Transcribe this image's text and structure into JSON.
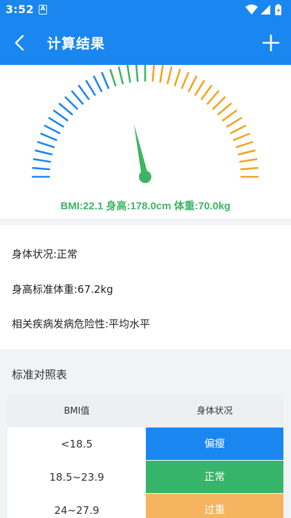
{
  "status_bar": {
    "time": "3:52",
    "notification_icon": "a-icon",
    "icons": [
      "wifi-icon",
      "signal-icon",
      "battery-icon"
    ]
  },
  "app_bar": {
    "title": "计算结果",
    "back_icon": "back-arrow-icon",
    "add_icon": "plus-icon"
  },
  "gauge": {
    "reading": "BMI:22.1  身高:178.0cm  体重:70.0kg",
    "colors": {
      "underweight": "#1a86f0",
      "normal": "#3db462",
      "overweight": "#f0a41e",
      "needle": "#3db462"
    }
  },
  "result": {
    "body_status": "身体状况:正常",
    "standard_weight": "身高标准体重:67.2kg",
    "disease_risk": "相关疾病发病危险性:平均水平"
  },
  "reference": {
    "title": "标准对照表",
    "headers": [
      "BMI值",
      "身体状况"
    ],
    "rows": [
      {
        "range": "<18.5",
        "status": "偏瘦",
        "color": "#1a86f0"
      },
      {
        "range": "18.5~23.9",
        "status": "正常",
        "color": "#35b46a"
      },
      {
        "range": "24~27.9",
        "status": "过重",
        "color": "#f4b460"
      }
    ]
  }
}
